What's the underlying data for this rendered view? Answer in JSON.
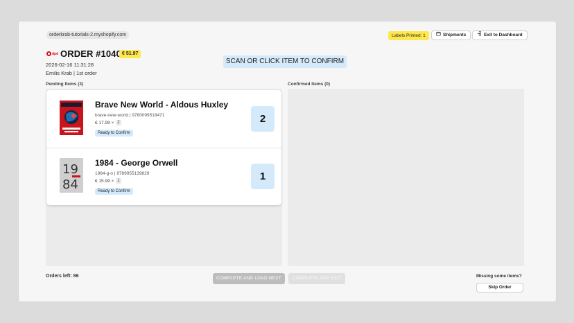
{
  "header": {
    "store_domain": "orderkrab-tutorials-2.myshopify.com",
    "labels_printed": "Labels Printed: 1",
    "shipments_label": "Shipments",
    "exit_label": "Exit to Dashboard"
  },
  "order": {
    "carrier": "dpd",
    "title": "ORDER #1040",
    "total": "€ 51.97",
    "date": "2026-02-16 11:31:28",
    "customer": "Emilis Krab | 1st order"
  },
  "scan_banner": "SCAN OR CLICK ITEM TO CONFIRM",
  "pending": {
    "header": "Pending Items (3)",
    "items": [
      {
        "title": "Brave New World - Aldous Huxley",
        "meta": "brave-new-world | 9780099518471",
        "price": "€ 17.99 ×",
        "qty_chip": "2",
        "status": "Ready to Confirm",
        "qty_box": "2"
      },
      {
        "title": "1984 - George Orwell",
        "meta": "1984-g-o | 9789955139829",
        "price": "€ 15.99 ×",
        "qty_chip": "1",
        "status": "Ready to Confirm",
        "qty_box": "1"
      }
    ]
  },
  "confirmed": {
    "header": "Confirmed Items (0)"
  },
  "footer": {
    "orders_left": "Orders left: 86",
    "complete_load_next": "COMPLETE AND LOAD NEXT",
    "complete_exit": "COMPLETE AND EXIT",
    "missing_items": "Missing some items?",
    "skip_order": "Skip Order"
  },
  "colors": {
    "accent_yellow": "#ffe84d",
    "accent_blue": "#d4eafb",
    "disabled_grey": "#bdbdbd",
    "carrier_red": "#d5111c"
  }
}
